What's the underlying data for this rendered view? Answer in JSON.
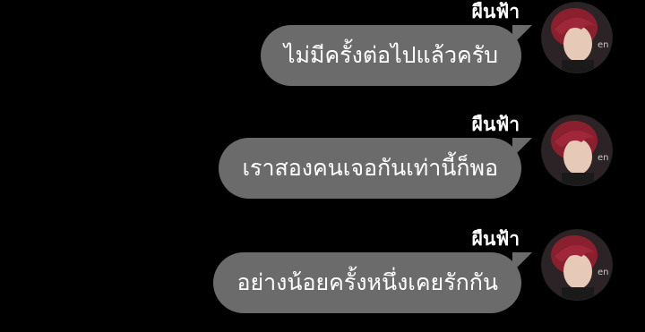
{
  "messages": [
    {
      "sender": "ผืนฟ้า",
      "text": "ไม่มีครั้งต่อไปแล้วครับ",
      "avatar_icon": "profile-avatar-icon"
    },
    {
      "sender": "ผืนฟ้า",
      "text": "เราสองคนเจอกันเท่านี้ก็พอ",
      "avatar_icon": "profile-avatar-icon"
    },
    {
      "sender": "ผืนฟ้า",
      "text": "อย่างน้อยครั้งหนึ่งเคยรักกัน",
      "avatar_icon": "profile-avatar-icon"
    }
  ],
  "colors": {
    "background": "#000000",
    "bubble": "#6b6b6b",
    "text": "#ffffff",
    "hair": "#8a1f2e"
  }
}
